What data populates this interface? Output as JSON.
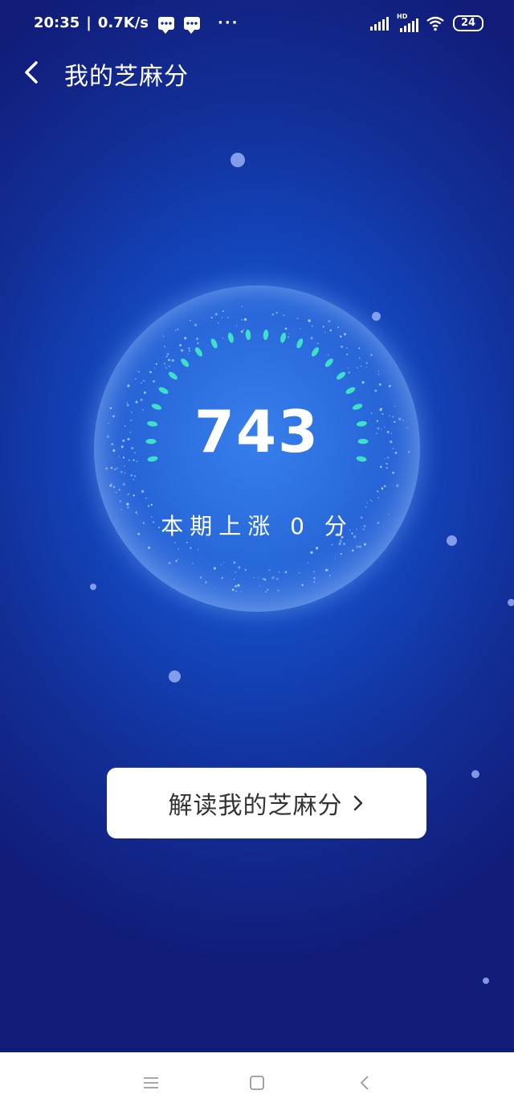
{
  "status_bar": {
    "time": "20:35",
    "speed": "0.7K/s",
    "battery": "24",
    "more": "···",
    "hd_label": "HD"
  },
  "header": {
    "title": "我的芝麻分"
  },
  "score": {
    "value": "743",
    "change_text": "本期上涨 0 分"
  },
  "interpret_button": {
    "label": "解读我的芝麻分"
  },
  "colors": {
    "background": "#1448c0",
    "gauge_dash": "#3fe0c8",
    "button_bg": "#ffffff",
    "button_text": "#333333"
  }
}
